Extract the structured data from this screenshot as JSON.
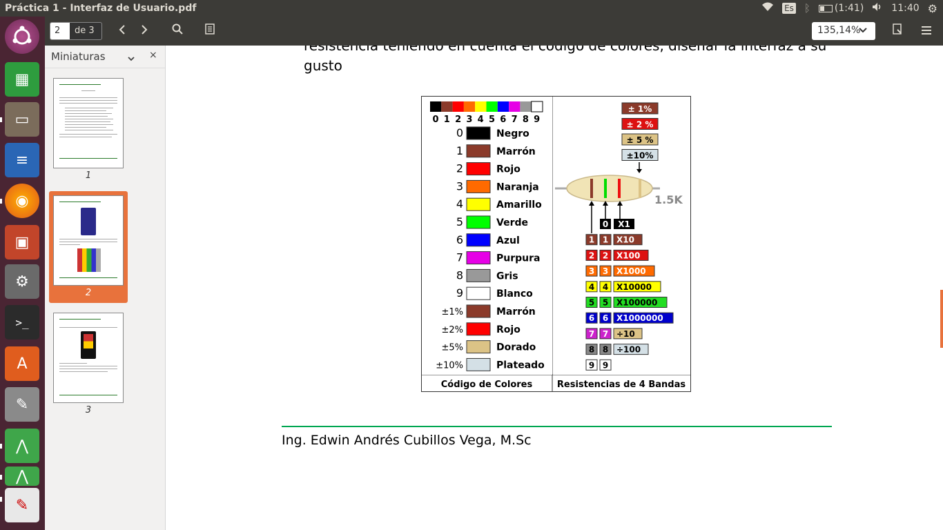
{
  "window": {
    "title": "Práctica 1 - Interfaz de Usuario.pdf"
  },
  "topbar": {
    "keyboard": "Es",
    "battery": "(1:41)",
    "clock": "11:40"
  },
  "toolbar": {
    "current_page": "2",
    "page_total": "de 3",
    "zoom": "135,14%"
  },
  "sidebar": {
    "title": "Miniaturas",
    "thumbnails": [
      {
        "label": "1"
      },
      {
        "label": "2"
      },
      {
        "label": "3"
      }
    ]
  },
  "document": {
    "line1": "resistencia teniendo en cuenta el código de colores, diseñar la interfaz a su",
    "line2": "gusto",
    "footer": "Ing. Edwin Andrés Cubillos Vega, M.Sc"
  },
  "figure": {
    "strip_digits": [
      "0",
      "1",
      "2",
      "3",
      "4",
      "5",
      "6",
      "7",
      "8",
      "9"
    ],
    "colors": [
      {
        "num": "0",
        "name": "Negro",
        "hex": "#000000"
      },
      {
        "num": "1",
        "name": "Marrón",
        "hex": "#8b3a2a"
      },
      {
        "num": "2",
        "name": "Rojo",
        "hex": "#ff0000"
      },
      {
        "num": "3",
        "name": "Naranja",
        "hex": "#ff6a00"
      },
      {
        "num": "4",
        "name": "Amarillo",
        "hex": "#ffff00"
      },
      {
        "num": "5",
        "name": "Verde",
        "hex": "#00ff00"
      },
      {
        "num": "6",
        "name": "Azul",
        "hex": "#0000ff"
      },
      {
        "num": "7",
        "name": "Purpura",
        "hex": "#e600e6"
      },
      {
        "num": "8",
        "name": "Gris",
        "hex": "#999999"
      },
      {
        "num": "9",
        "name": "Blanco",
        "hex": "#ffffff"
      },
      {
        "num": "±1%",
        "name": "Marrón",
        "hex": "#8b3a2a"
      },
      {
        "num": "±2%",
        "name": "Rojo",
        "hex": "#ff0000"
      },
      {
        "num": "±5%",
        "name": "Dorado",
        "hex": "#dcc386"
      },
      {
        "num": "±10%",
        "name": "Plateado",
        "hex": "#d4e0e6"
      }
    ],
    "tolerances": [
      {
        "label": "± 1%",
        "hex": "#8b3a2a",
        "fg": "#ffffff"
      },
      {
        "label": "± 2 %",
        "hex": "#dd1111",
        "fg": "#ffffff"
      },
      {
        "label": "± 5 %",
        "hex": "#dcc386",
        "fg": "#000000"
      },
      {
        "label": "±10%",
        "hex": "#d4e0e6",
        "fg": "#000000"
      }
    ],
    "resistor_value": "1.5K",
    "multiplier_rows": [
      {
        "d": "0",
        "m": "X1",
        "hex": "#000000",
        "fg": "#ffffff"
      },
      {
        "d": "1",
        "m": "X10",
        "hex": "#8b3a2a",
        "fg": "#ffffff"
      },
      {
        "d": "2",
        "m": "X100",
        "hex": "#dd1111",
        "fg": "#ffffff"
      },
      {
        "d": "3",
        "m": "X1000",
        "hex": "#ff6a00",
        "fg": "#ffffff"
      },
      {
        "d": "4",
        "m": "X10000",
        "hex": "#ffff00",
        "fg": "#000000"
      },
      {
        "d": "5",
        "m": "X100000",
        "hex": "#22dd22",
        "fg": "#000000"
      },
      {
        "d": "6",
        "m": "X1000000",
        "hex": "#0000cc",
        "fg": "#ffffff"
      },
      {
        "d": "7",
        "m": "÷10",
        "hex": "#cc22cc",
        "fg": "#ffffff"
      },
      {
        "d": "8",
        "m": "÷100",
        "hex": "#888888",
        "fg": "#000000"
      },
      {
        "d": "9",
        "m": "",
        "hex": "#ffffff",
        "fg": "#000000"
      }
    ],
    "multiplier_hex": [
      "",
      "#8b3a2a",
      "#dd1111",
      "#ff6a00",
      "#ffff00",
      "#22dd22",
      "#0000cc",
      "#dcc386",
      "#d4e0e6",
      ""
    ],
    "caption_left": "Código de Colores",
    "caption_right": "Resistencias de 4 Bandas"
  }
}
